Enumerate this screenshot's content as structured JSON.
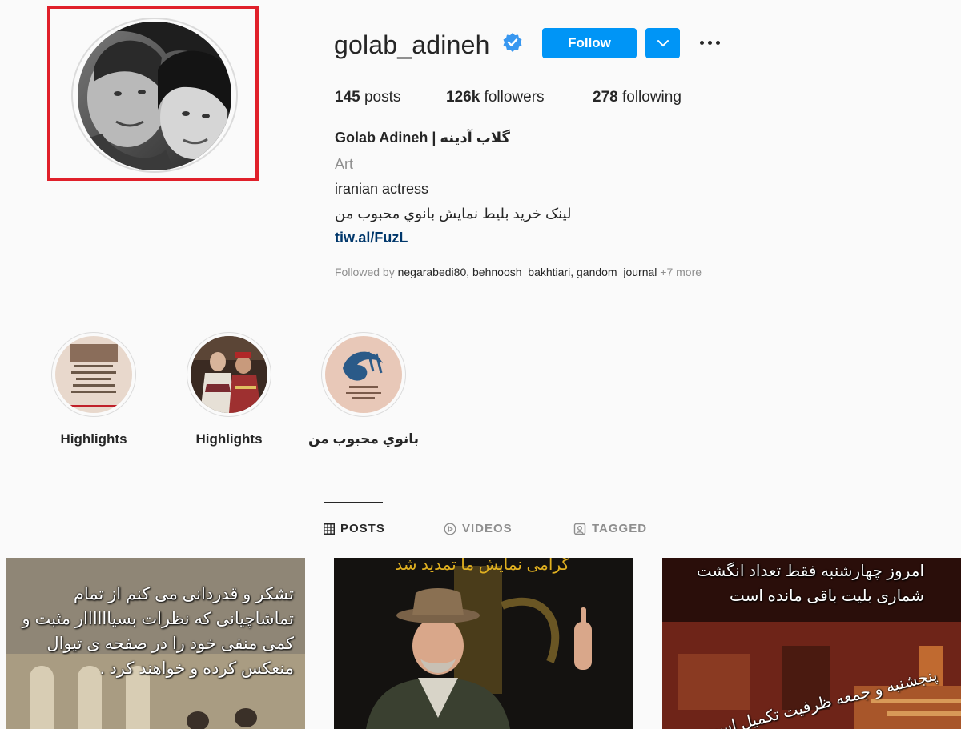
{
  "profile": {
    "username": "golab_adineh",
    "follow_label": "Follow",
    "stats": {
      "posts": "145",
      "posts_label": " posts",
      "followers": "126k",
      "followers_label": " followers",
      "following": "278",
      "following_label": " following"
    },
    "full_name": "Golab Adineh | گلاب آدینه",
    "category": "Art",
    "bio_lines": [
      "iranian actress",
      "لینک خرید بلیط نمایش بانوي محبوب من"
    ],
    "link": "tiw.al/FuzL",
    "followed_by_prefix": "Followed by ",
    "followed_by_names": "negarabedi80, behnoosh_bakhtiari, gandom_journal",
    "followed_by_more": " +7 more"
  },
  "highlights": [
    {
      "label": "Highlights"
    },
    {
      "label": "Highlights"
    },
    {
      "label": "بانوي محبوب من"
    }
  ],
  "tabs": [
    {
      "label": "POSTS",
      "icon": "grid-icon",
      "active": true
    },
    {
      "label": "VIDEOS",
      "icon": "play-icon",
      "active": false
    },
    {
      "label": "TAGGED",
      "icon": "tag-icon",
      "active": false
    }
  ],
  "posts": [
    {
      "text": "تشکر و قدردانی می کنم از تمام تماشاچیانی که نظرات بسیاااااار مثبت و کمی منفی خود را در صفحه ی تیوال منعکس کرده و خواهند کرد ."
    },
    {
      "text": "گرامی نمایش ما تمدید شد"
    },
    {
      "text": "امروز چهارشنبه فقط تعداد انگشت شماری بلیت باقی مانده است",
      "text2": "پنجشنبه و جمعه ظرفیت تکمیل است"
    }
  ],
  "colors": {
    "accent": "#0095f6",
    "highlight_box": "#e0202a",
    "verified": "#3897f0",
    "link": "#00376b"
  }
}
